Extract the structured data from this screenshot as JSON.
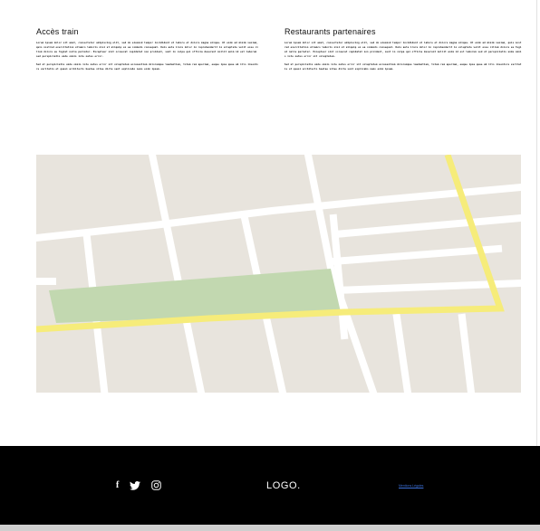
{
  "sections": {
    "train": {
      "title": "Accès train",
      "paragraphs": [
        "Lorem ipsum dolor sit amet, consectetur adipiscing elit, sed do eiusmod tempor incididunt ut labore et dolore magna aliqua. Ut enim ad minim veniam, quis nostrud exercitation ullamco laboris nisi ut aliquip ex ea commodo consequat. Duis aute irure dolor in reprehenderit in voluptate velit esse cillum dolore eu fugiat nulla pariatur. Excepteur sint occaecat cupidatat non proident, sunt in culpa qui officia deserunt mollit anim id est laborum sed perspiciatis unde omnis iste natus error.",
        "Sed ut perspiciatis unde omnis iste natus error sit voluptatem accusantium doloremque laudantium, totam rem aperiam, eaque ipsa quae ab illo inventore veritatis et quasi architecto beatae vitae dicta sunt explicabo nemo enim ipsam."
      ]
    },
    "restaurants": {
      "title": "Restaurants partenaires",
      "paragraphs": [
        "Lorem ipsum dolor sit amet, consectetur adipiscing elit, sed do eiusmod tempor incididunt ut labore et dolore magna aliqua. Ut enim ad minim veniam, quis nostrud exercitation ullamco laboris nisi ut aliquip ex ea commodo consequat. Duis aute irure dolor in reprehenderit in voluptate velit esse cillum dolore eu fugiat nulla pariatur. Excepteur sint occaecat cupidatat non proident, sunt in culpa qui officia deserunt mollit anim id est laborum sed ut perspiciatis unde omnis iste natus error sit voluptatem.",
        "Sed ut perspiciatis unde omnis iste natus error sit voluptatem accusantium doloremque laudantium, totam rem aperiam, eaque ipsa quae ab illo inventore veritatis et quasi architecto beatae vitae dicta sunt explicabo nemo enim ipsam."
      ]
    }
  },
  "map": {
    "colors": {
      "land": "#e8e4dd",
      "street": "#ffffff",
      "highlight_road": "#f6ec7a",
      "park": "#c2d8b0"
    }
  },
  "footer": {
    "social_icons": [
      "facebook-icon",
      "twitter-icon",
      "instagram-icon"
    ],
    "facebook_glyph": "f",
    "logo": "LOGO.",
    "legal_link": "Mentions Légales"
  }
}
